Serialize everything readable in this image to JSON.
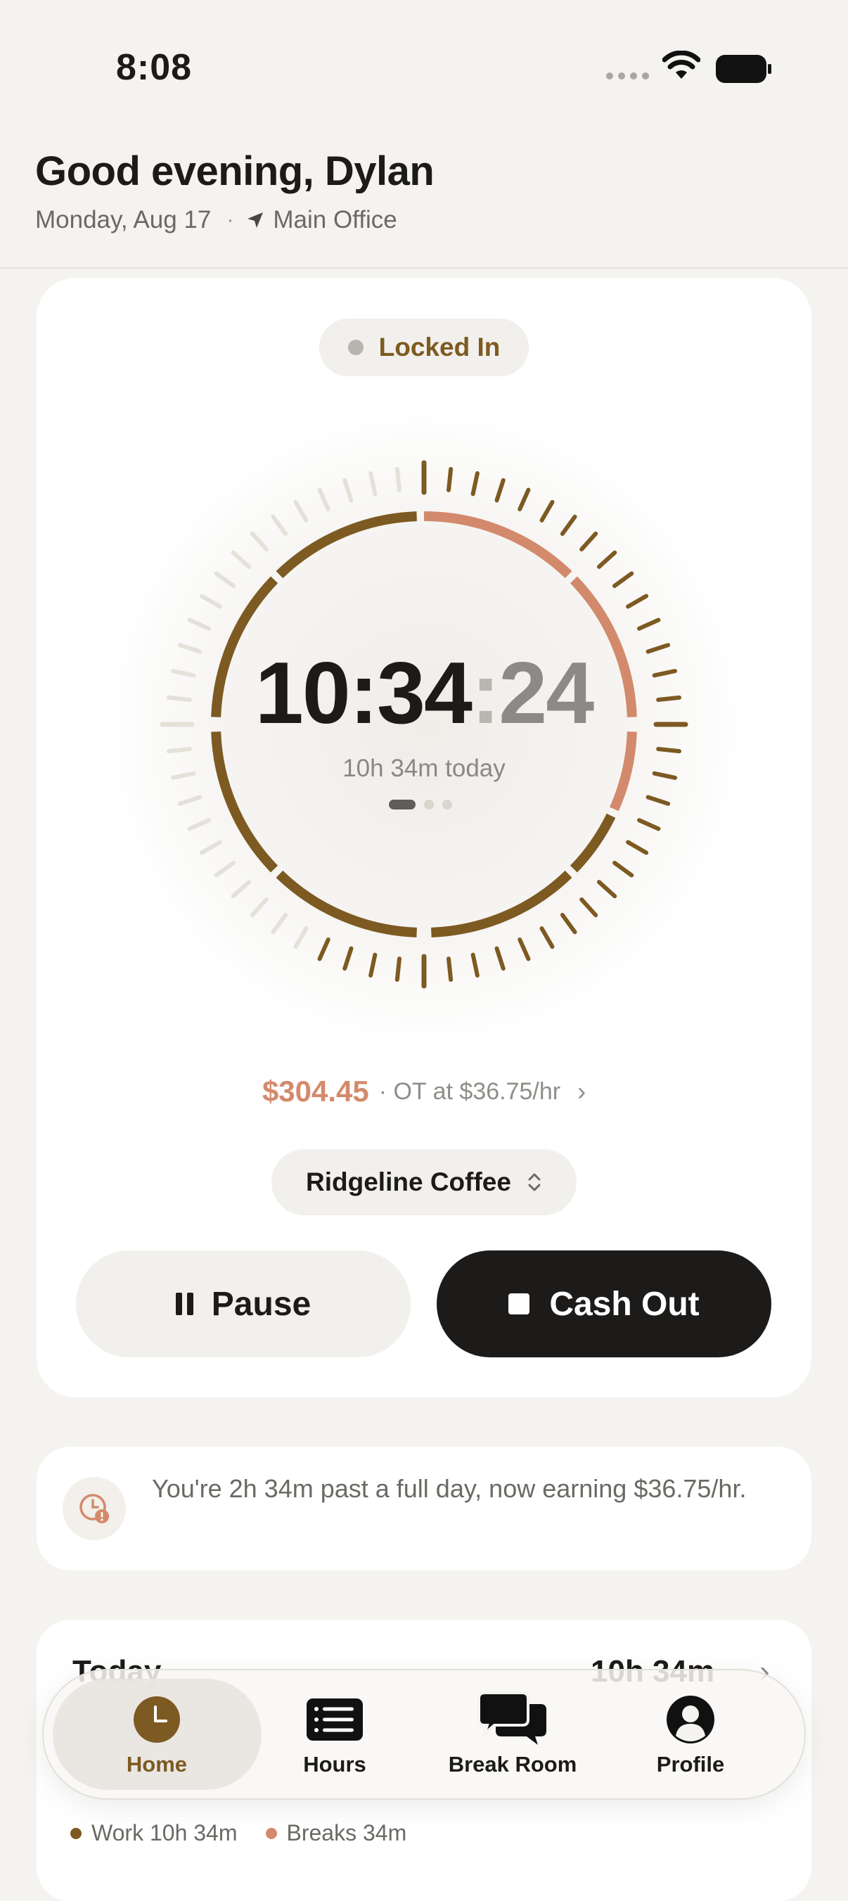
{
  "status_bar": {
    "time": "8:08"
  },
  "header": {
    "greeting": "Good evening, Dylan",
    "date": "Monday, Aug 17",
    "separator": "·",
    "location": "Main Office"
  },
  "timer": {
    "status": "Locked In",
    "time_hm": "10:34",
    "time_colon": ":",
    "time_seconds": "24",
    "today_summary": "10h 34m today",
    "page_count": 3,
    "active_page": 1,
    "earnings_amount": "$304.45",
    "earnings_rate": "· OT at $36.75/hr",
    "job_name": "Ridgeline Coffee",
    "pause_label": "Pause",
    "cash_out_label": "Cash Out"
  },
  "overtime_notice": {
    "text": "You're 2h 34m past a full day, now earning $36.75/hr."
  },
  "today_card": {
    "title": "Today",
    "total": "10h 34m",
    "legend": [
      {
        "label": "Work 10h 34m",
        "color": "#7d5a22"
      },
      {
        "label": "Breaks 34m",
        "color": "#d38a6c"
      }
    ]
  },
  "tab_bar": {
    "tabs": [
      {
        "label": "Home",
        "icon": "clock-icon",
        "active": true
      },
      {
        "label": "Hours",
        "icon": "list-icon",
        "active": false
      },
      {
        "label": "Break Room",
        "icon": "chat-bubbles-icon",
        "active": false
      },
      {
        "label": "Profile",
        "icon": "person-icon",
        "active": false
      }
    ]
  },
  "colors": {
    "accent_brown": "#7d5a22",
    "accent_salmon": "#d38a6c",
    "dark": "#1c1b19",
    "background": "#f4f3f0"
  }
}
